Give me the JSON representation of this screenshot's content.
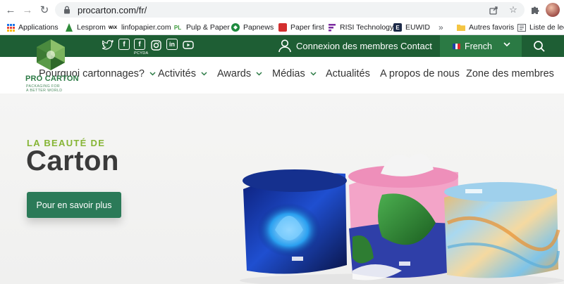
{
  "browser": {
    "url": "procarton.com/fr/",
    "bookmarks": [
      {
        "label": "Applications",
        "icon": "apps-grid-icon"
      },
      {
        "label": "Lesprom",
        "icon": "lesprom-icon"
      },
      {
        "label": "linfopapier.com",
        "icon": "wix-icon",
        "badge": "WiX"
      },
      {
        "label": "Pulp & Paper",
        "icon": "pulp-paper-icon",
        "badge": "PL"
      },
      {
        "label": "Papnews",
        "icon": "papnews-icon"
      },
      {
        "label": "Paper first",
        "icon": "paper-first-icon"
      },
      {
        "label": "RISI Technology",
        "icon": "risi-icon"
      },
      {
        "label": "EUWID",
        "icon": "euwid-icon",
        "badge": "E"
      },
      {
        "label": "Autres favoris",
        "icon": "folder-icon"
      },
      {
        "label": "Liste de lecture",
        "icon": "reading-list-icon"
      }
    ],
    "overflow_label": "»"
  },
  "topbar": {
    "social_caption": "PCYDA",
    "member_login": "Connexion des membres",
    "contact": "Contact",
    "language": "French"
  },
  "logo": {
    "wordmark": "PRO CARTON",
    "tagline_line1": "PACKAGING FOR",
    "tagline_line2": "A BETTER WORLD"
  },
  "nav": {
    "items": [
      {
        "label": "Pourquoi cartonnages?",
        "has_dropdown": true
      },
      {
        "label": "Activités",
        "has_dropdown": true
      },
      {
        "label": "Awards",
        "has_dropdown": true
      },
      {
        "label": "Médias",
        "has_dropdown": true
      },
      {
        "label": "Actualités",
        "has_dropdown": false
      },
      {
        "label": "A propos de nous",
        "has_dropdown": false
      },
      {
        "label": "Zone des membres",
        "has_dropdown": false
      }
    ]
  },
  "hero": {
    "eyebrow": "LA BEAUTÉ DE",
    "title": "Carton",
    "cta": "Pour en savoir plus"
  },
  "colors": {
    "brand_green": "#1e5e34",
    "lang_green": "#2b7a44",
    "accent_lime": "#86b535",
    "cta_green": "#2b7a58"
  }
}
